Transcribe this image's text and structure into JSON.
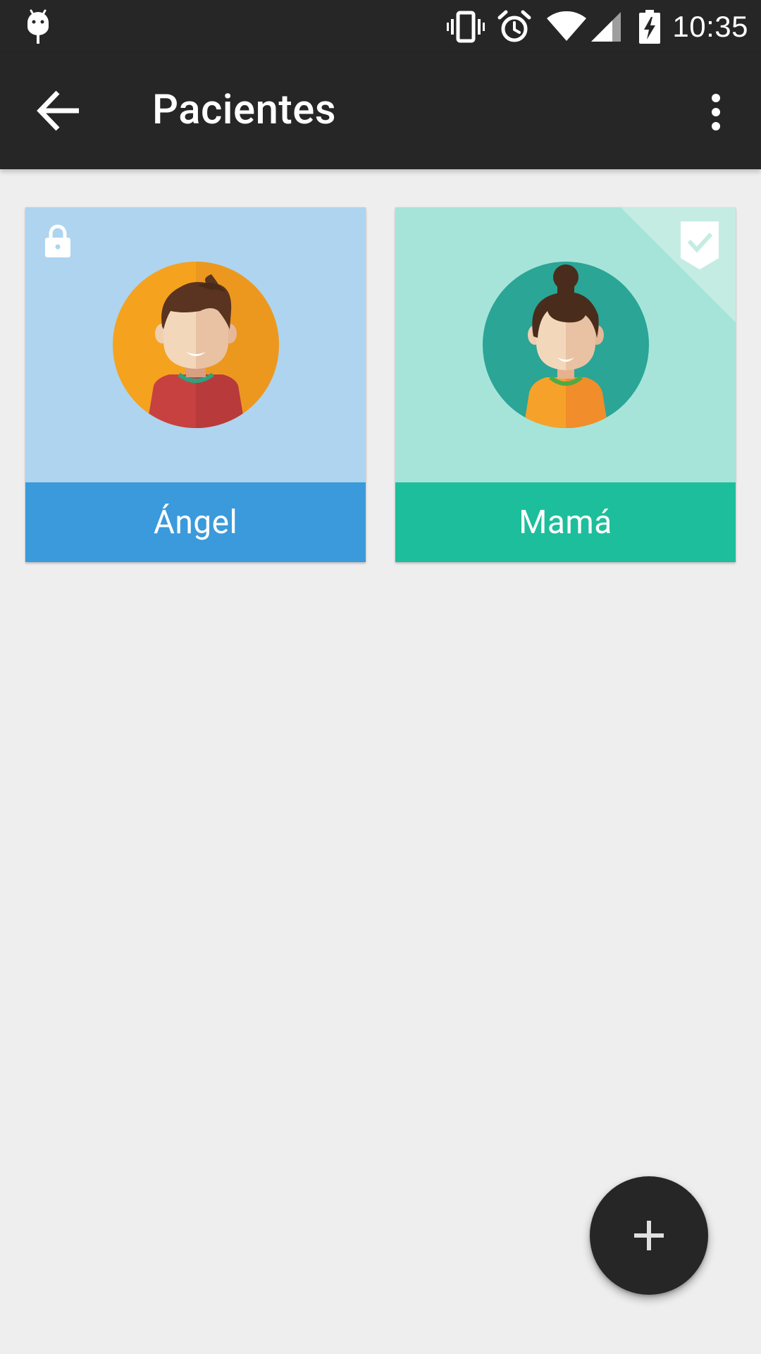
{
  "status_bar": {
    "time": "10:35",
    "icons": [
      "android-debug-icon",
      "vibrate-icon",
      "alarm-icon",
      "wifi-icon",
      "signal-icon",
      "battery-charging-icon"
    ]
  },
  "app_bar": {
    "title": "Pacientes",
    "back_icon": "arrow-back-icon",
    "menu_icon": "more-vert-icon"
  },
  "patients": [
    {
      "name": "Ángel",
      "badge": "lock-icon",
      "image_bg": "#aed4ef",
      "label_bg": "#3a9adb",
      "avatar_bg": "#f5a21e"
    },
    {
      "name": "Mamá",
      "badge": "check-shield-icon",
      "selected": true,
      "image_bg": "#a6e4d9",
      "label_bg": "#1dbe9b",
      "avatar_bg": "#2aa596"
    }
  ],
  "fab": {
    "icon": "add-icon"
  },
  "colors": {
    "bar": "#262626",
    "background": "#eeeeee"
  }
}
